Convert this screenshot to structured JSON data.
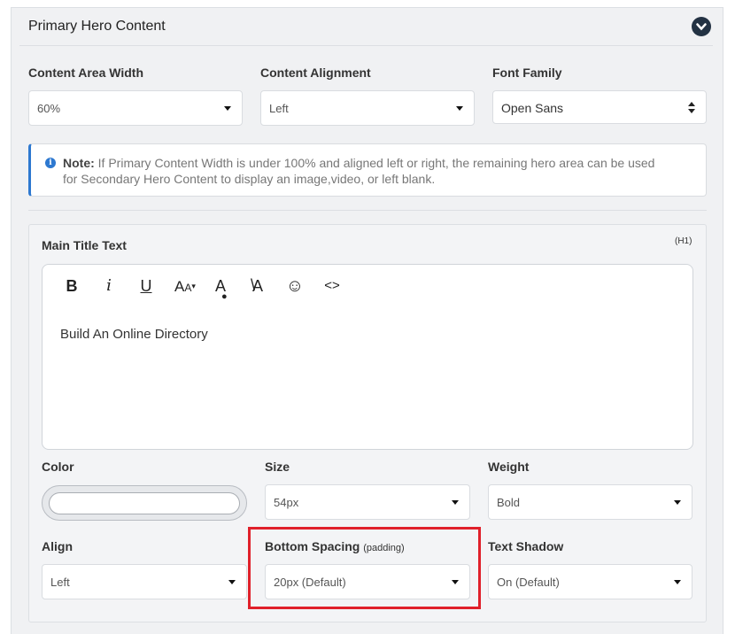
{
  "section": {
    "title": "Primary Hero Content",
    "collapse_icon": "chevron-down-icon"
  },
  "layout_fields": [
    {
      "label": "Content Area Width",
      "value": "60%"
    },
    {
      "label": "Content Alignment",
      "value": "Left"
    },
    {
      "label": "Font Family",
      "value": "Open Sans"
    }
  ],
  "note": {
    "icon": "info-icon",
    "bold": "Note:",
    "line1": " If Primary Content Width is under 100% and aligned left or right, the remaining hero area can be used",
    "line2": "for Secondary Hero Content to display an image,video, or left blank."
  },
  "title_panel": {
    "label": "Main Title Text",
    "tag": "(H1)",
    "toolbar": [
      {
        "name": "bold",
        "glyph": "B"
      },
      {
        "name": "italic",
        "glyph": "i"
      },
      {
        "name": "underline",
        "glyph": "U"
      },
      {
        "name": "font-size",
        "glyph": "AA"
      },
      {
        "name": "text-color",
        "glyph": "A"
      },
      {
        "name": "clear-format",
        "glyph": "A"
      },
      {
        "name": "emoji",
        "glyph": "☺"
      },
      {
        "name": "code-view",
        "glyph": "<>"
      }
    ],
    "content": "Build An Online Directory"
  },
  "style_fields": {
    "color": {
      "label": "Color"
    },
    "size": {
      "label": "Size",
      "value": "54px"
    },
    "weight": {
      "label": "Weight",
      "value": "Bold"
    },
    "align": {
      "label": "Align",
      "value": "Left"
    },
    "bottom_spacing": {
      "label": "Bottom Spacing",
      "hint": "(padding)",
      "value": "20px (Default)"
    },
    "text_shadow": {
      "label": "Text Shadow",
      "value": "On (Default)"
    }
  },
  "colors": {
    "accent": "#2d78d0",
    "highlight": "#e0202a",
    "header_button": "#233243"
  }
}
